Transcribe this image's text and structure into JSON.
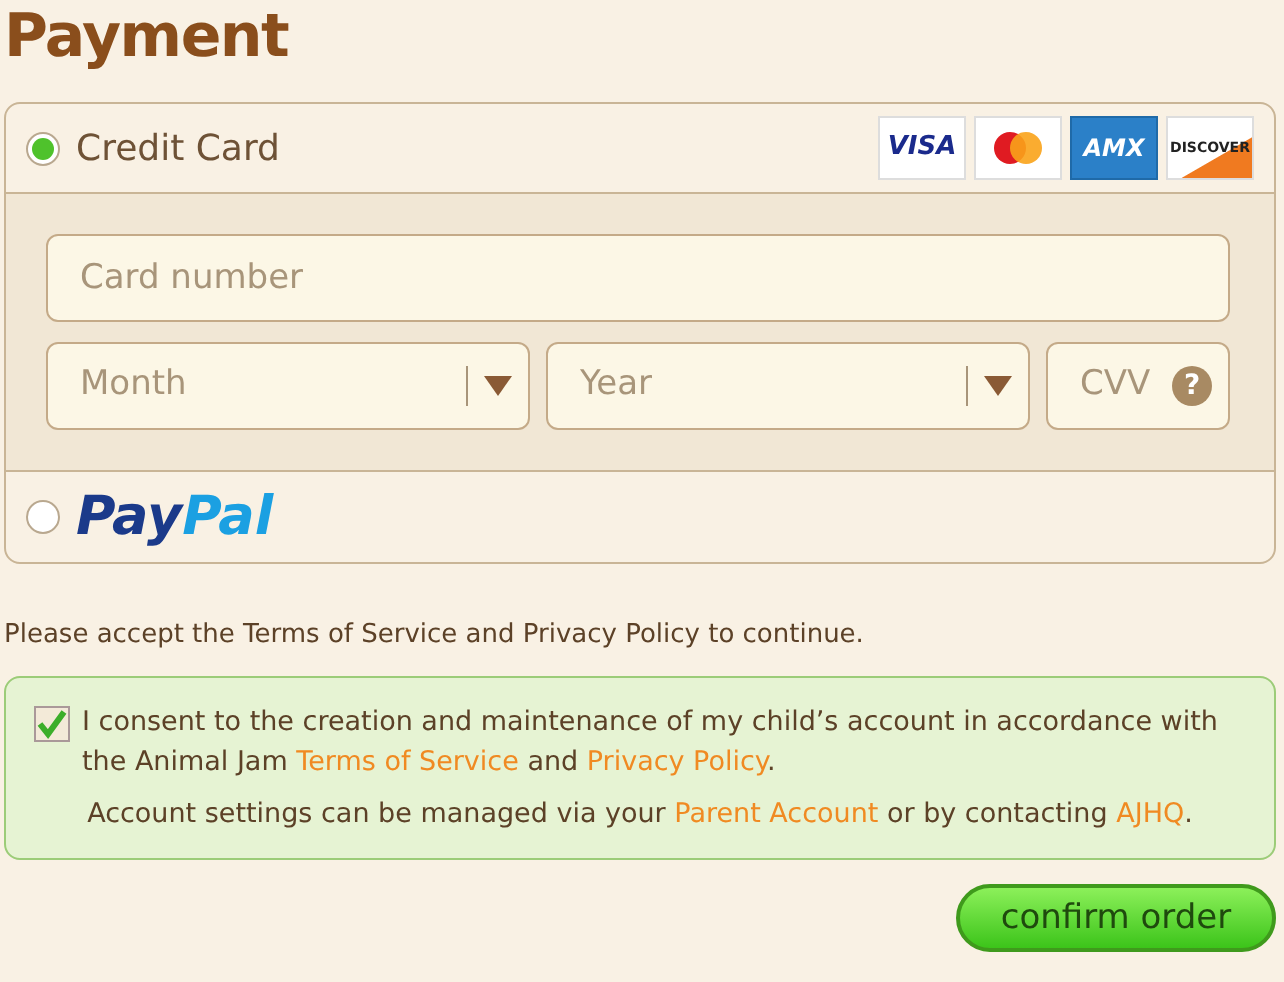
{
  "title": "Payment",
  "methods": [
    {
      "kind": "card",
      "label": "Credit Card",
      "selected": true,
      "cards": [
        {
          "kind": "visa",
          "text": "VISA"
        },
        {
          "kind": "mastercard"
        },
        {
          "kind": "amex",
          "text": "AMX"
        },
        {
          "kind": "discover",
          "text": "DISCOVER"
        }
      ],
      "fields": [
        {
          "kind": "text",
          "placeholder": "Card number"
        },
        {
          "kind": "select",
          "placeholder": "Month"
        },
        {
          "kind": "select",
          "placeholder": "Year"
        },
        {
          "kind": "cvv",
          "placeholder": "CVV",
          "help": "?"
        }
      ]
    },
    {
      "kind": "paypal",
      "logo_parts": [
        "Pay",
        "Pal"
      ],
      "selected": false
    }
  ],
  "notice": "Please accept the Terms of Service and Privacy Policy to continue.",
  "consent": {
    "checked": true,
    "lines": [
      [
        {
          "kind": "text",
          "text": "I consent to the creation and maintenance of my child’s account in accordance with the Animal Jam "
        },
        {
          "kind": "link",
          "text": "Terms of Service"
        },
        {
          "kind": "text",
          "text": " and "
        },
        {
          "kind": "link",
          "text": "Privacy Policy"
        },
        {
          "kind": "text",
          "text": "."
        }
      ],
      [
        {
          "kind": "text",
          "text": "Account settings can be managed via your "
        },
        {
          "kind": "link",
          "text": "Parent Account"
        },
        {
          "kind": "text",
          "text": " or by contacting "
        },
        {
          "kind": "link",
          "text": "AJHQ"
        },
        {
          "kind": "text",
          "text": "."
        }
      ]
    ]
  },
  "button": "confirm order"
}
